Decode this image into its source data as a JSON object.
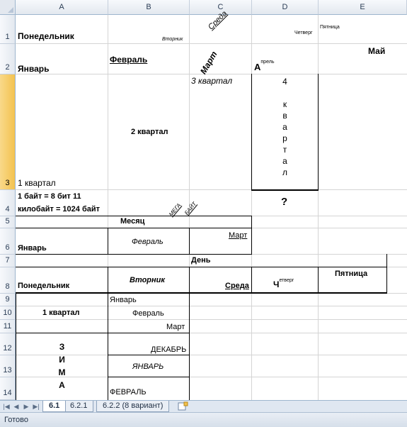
{
  "columns": [
    "A",
    "B",
    "C",
    "D",
    "E"
  ],
  "rows": [
    "1",
    "2",
    "3",
    "4",
    "5",
    "6",
    "7",
    "8",
    "9",
    "10",
    "11",
    "12",
    "13",
    "14"
  ],
  "selected_row": "3",
  "cells": {
    "a1": "Понедельник",
    "b1": "Вторник",
    "c1": "Среда",
    "d1": "Четверг",
    "e1": "Пятница",
    "a2": "Январь",
    "b2": "Февраль",
    "c2": "Март",
    "d2_cap": "А",
    "d2_rest": "прель",
    "e2": "Май",
    "a3": "1 квартал",
    "b3": "2 квартал",
    "c3": "3 квартал",
    "d3_letters": [
      "4",
      "",
      "к",
      "в",
      "а",
      "р",
      "т",
      "а",
      "л"
    ],
    "a4_line1": "1 байт = 8 бит  11",
    "a4_line2": "килобайт = 1024 байт",
    "c4_mega": "МЕГА",
    "c4_bait": "БАЙТ",
    "d4": "?",
    "b5": "Месяц",
    "a6": "Январь",
    "b6": "Февраль",
    "c6": "Март",
    "c7": "День",
    "a8": "Понедельник",
    "b8": "Вторник",
    "c8": "Среда",
    "d8_cap": "Ч",
    "d8_rest": "етверг",
    "e8": "Пятница",
    "b9": "Январь",
    "a10": "1 квартал",
    "b10": "Февраль",
    "b11": "Март",
    "a_zima": [
      "З",
      "И",
      "М",
      "А"
    ],
    "b12": "ДЕКАБРЬ",
    "b13": "ЯНВАРЬ",
    "b14": "ФЕВРАЛЬ"
  },
  "sheet_tabs": [
    "6.1",
    "6.2.1",
    "6.2.2 (8 вариант)"
  ],
  "active_tab": "6.1",
  "status": "Готово"
}
